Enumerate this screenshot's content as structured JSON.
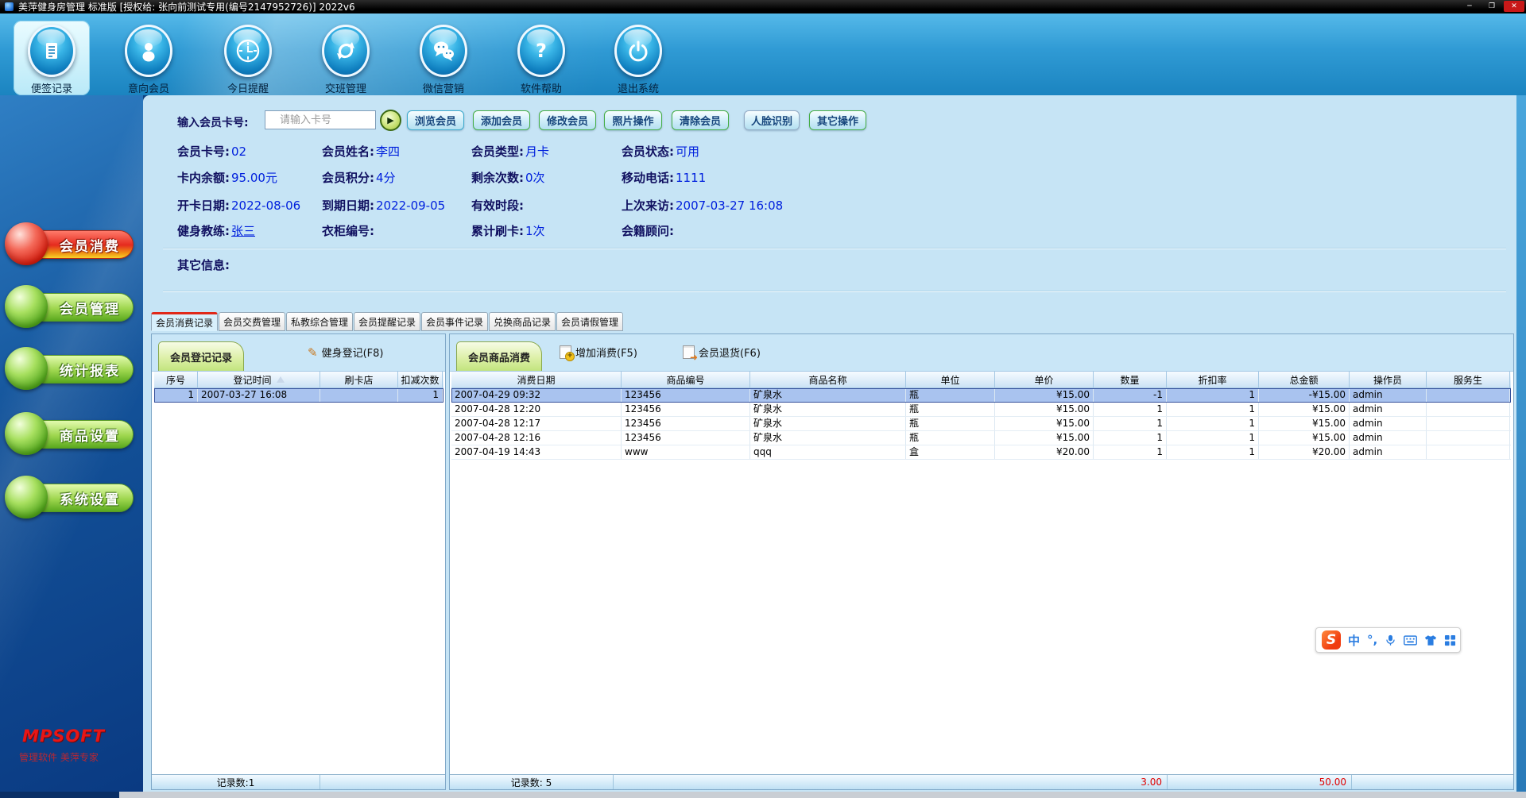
{
  "window": {
    "title": "美萍健身房管理 标准版 [授权给: 张向前测试专用(编号2147952726)]  2022v6",
    "minimize": "─",
    "maximize": "❐",
    "close": "✕"
  },
  "toolbar": {
    "items": [
      {
        "label": "便签记录",
        "icon": "note-icon",
        "active": true
      },
      {
        "label": "意向会员",
        "icon": "member-icon",
        "active": false
      },
      {
        "label": "今日提醒",
        "icon": "clock-icon",
        "active": false
      },
      {
        "label": "交班管理",
        "icon": "shift-refresh-icon",
        "active": false
      },
      {
        "label": "微信营销",
        "icon": "wechat-icon",
        "active": false
      },
      {
        "label": "软件帮助",
        "icon": "help-icon",
        "active": false
      },
      {
        "label": "退出系统",
        "icon": "power-icon",
        "active": false
      }
    ]
  },
  "sidebar": {
    "items": [
      {
        "label": "会员消费",
        "active": true
      },
      {
        "label": "会员管理",
        "active": false
      },
      {
        "label": "统计报表",
        "active": false
      },
      {
        "label": "商品设置",
        "active": false
      },
      {
        "label": "系统设置",
        "active": false
      }
    ],
    "logo": "MPSOFT",
    "slogan": "管理软件 美萍专家"
  },
  "search": {
    "label": "输入会员卡号:",
    "placeholder": "请输入卡号",
    "go_glyph": "▶",
    "buttons": [
      {
        "label": "浏览会员"
      },
      {
        "label": "添加会员"
      },
      {
        "label": "修改会员"
      },
      {
        "label": "照片操作"
      },
      {
        "label": "清除会员"
      },
      {
        "label": "人脸识别"
      },
      {
        "label": "其它操作"
      }
    ]
  },
  "member_info": {
    "rows": [
      [
        {
          "label": "会员卡号:",
          "value": "02"
        },
        {
          "label": "会员姓名:",
          "value": "李四"
        },
        {
          "label": "会员类型:",
          "value": "月卡"
        },
        {
          "label": "会员状态:",
          "value": "可用"
        }
      ],
      [
        {
          "label": "卡内余额:",
          "value": "95.00元"
        },
        {
          "label": "会员积分:",
          "value": "4分"
        },
        {
          "label": "剩余次数:",
          "value": "0次"
        },
        {
          "label": "移动电话:",
          "value": "1111"
        }
      ],
      [
        {
          "label": "开卡日期:",
          "value": "2022-08-06"
        },
        {
          "label": "到期日期:",
          "value": "2022-09-05"
        },
        {
          "label": "有效时段:",
          "value": ""
        },
        {
          "label": "上次来访:",
          "value": "2007-03-27 16:08"
        }
      ],
      [
        {
          "label": "健身教练:",
          "value": "张三"
        },
        {
          "label": "衣柜编号:",
          "value": ""
        },
        {
          "label": "累计刷卡:",
          "value": "1次"
        },
        {
          "label": "会籍顾问:",
          "value": ""
        }
      ]
    ],
    "other_info_label": "其它信息:"
  },
  "tabs": [
    {
      "label": "会员消费记录",
      "active": true
    },
    {
      "label": "会员交费管理",
      "active": false
    },
    {
      "label": "私教综合管理",
      "active": false
    },
    {
      "label": "会员提醒记录",
      "active": false
    },
    {
      "label": "会员事件记录",
      "active": false
    },
    {
      "label": "兑换商品记录",
      "active": false
    },
    {
      "label": "会员请假管理",
      "active": false
    }
  ],
  "left_panel": {
    "tab_label": "会员登记记录",
    "action_label": "健身登记(F8)",
    "columns": [
      "序号",
      "登记时间",
      "刷卡店",
      "扣减次数"
    ],
    "rows": [
      [
        "1",
        "2007-03-27 16:08",
        "",
        "1"
      ]
    ],
    "selected_row": 0,
    "record_count": "记录数:1"
  },
  "right_panel": {
    "tab_label": "会员商品消费",
    "actions": [
      {
        "label": "增加消费(F5)"
      },
      {
        "label": "会员退货(F6)"
      }
    ],
    "columns": [
      "消费日期",
      "商品编号",
      "商品名称",
      "单位",
      "单价",
      "数量",
      "折扣率",
      "总金额",
      "操作员",
      "服务生"
    ],
    "rows": [
      [
        "2007-04-29 09:32",
        "123456",
        "矿泉水",
        "瓶",
        "¥15.00",
        "-1",
        "1",
        "-¥15.00",
        "admin",
        ""
      ],
      [
        "2007-04-28 12:20",
        "123456",
        "矿泉水",
        "瓶",
        "¥15.00",
        "1",
        "1",
        "¥15.00",
        "admin",
        ""
      ],
      [
        "2007-04-28 12:17",
        "123456",
        "矿泉水",
        "瓶",
        "¥15.00",
        "1",
        "1",
        "¥15.00",
        "admin",
        ""
      ],
      [
        "2007-04-28 12:16",
        "123456",
        "矿泉水",
        "瓶",
        "¥15.00",
        "1",
        "1",
        "¥15.00",
        "admin",
        ""
      ],
      [
        "2007-04-19 14:43",
        "www",
        "qqq",
        "盒",
        "¥20.00",
        "1",
        "1",
        "¥20.00",
        "admin",
        ""
      ]
    ],
    "selected_row": 0,
    "record_count": "记录数: 5",
    "total_quantity": "3.00",
    "total_amount": "50.00"
  },
  "ime": {
    "logo": "S",
    "mode": "中",
    "punct": "°,"
  }
}
